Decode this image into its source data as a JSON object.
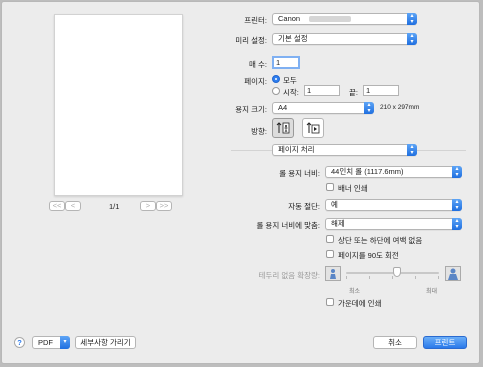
{
  "printer": {
    "label": "프린터:",
    "value": "Canon"
  },
  "presets": {
    "label": "미리 설정:",
    "value": "기본 설정"
  },
  "copies": {
    "label": "매 수:",
    "value": "1"
  },
  "pages": {
    "label": "페이지:",
    "all_label": "모두",
    "from_label": "시작:",
    "from_value": "1",
    "to_label": "끝:",
    "to_value": "1"
  },
  "paper_size": {
    "label": "용지 크기:",
    "value": "A4",
    "dimensions": "210 x 297mm"
  },
  "orientation": {
    "label": "방향:"
  },
  "section": {
    "value": "페이지 처리"
  },
  "roll_width": {
    "label": "롤 용지 너비:",
    "value": "44인치 롤 (1117.6mm)",
    "banner_label": "배너 인쇄"
  },
  "auto_cut": {
    "label": "자동 절단:",
    "value": "예"
  },
  "fit_roll": {
    "label": "롤 용지 너비에 맞춤:",
    "value": "해제",
    "no_margin_label": "상단 또는 하단에 여백 없음",
    "rotate_label": "페이지를 90도 회전"
  },
  "borderless": {
    "label": "테두리 없음 확장량:",
    "min_label": "최소",
    "max_label": "최대",
    "level": 0.55
  },
  "center_print": {
    "label": "가운데에 인쇄"
  },
  "preview_nav": {
    "page_indicator": "1/1",
    "first": "<<",
    "prev": "<",
    "next": ">",
    "last": ">>"
  },
  "footer": {
    "help": "?",
    "pdf": "PDF",
    "hide_details": "세부사항 가리기",
    "cancel": "취소",
    "print": "프린트"
  },
  "colors": {
    "accent": "#2a79ea",
    "window": "#ececec"
  }
}
